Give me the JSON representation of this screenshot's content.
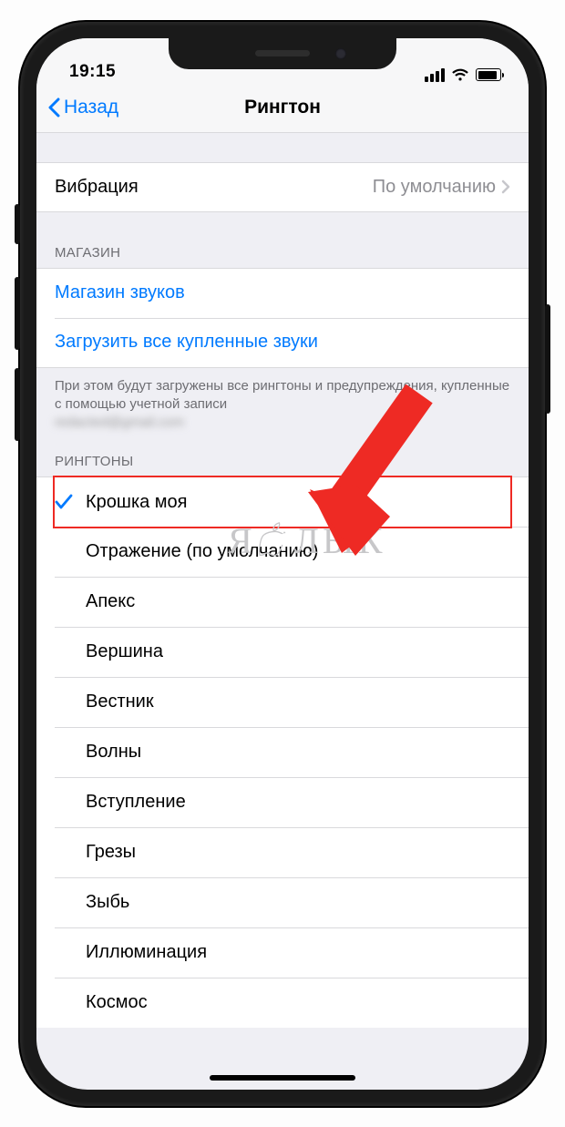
{
  "status": {
    "time": "19:15"
  },
  "nav": {
    "back": "Назад",
    "title": "Рингтон"
  },
  "vibration": {
    "label": "Вибрация",
    "value": "По умолчанию"
  },
  "store": {
    "header": "МАГАЗИН",
    "sound_store": "Магазин звуков",
    "download_all": "Загрузить все купленные звуки",
    "footer_line": "При этом будут загружены все рингтоны и предупреждения, купленные с помощью учетной записи",
    "footer_account": "redacted@gmail.com"
  },
  "ringtones": {
    "header": "РИНГТОНЫ",
    "selected_index": 0,
    "items": [
      "Крошка моя",
      "Отражение (по умолчанию)",
      "Апекс",
      "Вершина",
      "Вестник",
      "Волны",
      "Вступление",
      "Грезы",
      "Зыбь",
      "Иллюминация",
      "Космос"
    ]
  },
  "watermark": {
    "text_left": "Я",
    "text_right": "ЛЫК"
  },
  "colors": {
    "ios_blue": "#007aff",
    "annotation_red": "#ee2a24",
    "group_bg": "#efeff4"
  }
}
